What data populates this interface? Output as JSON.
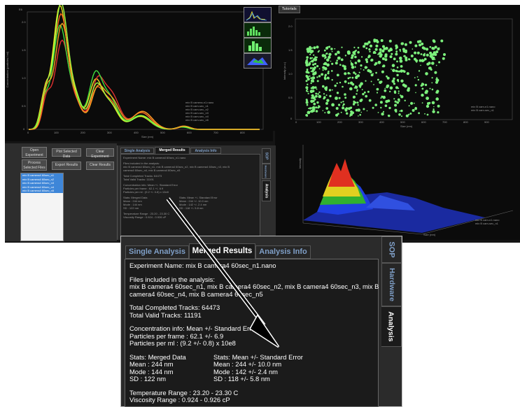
{
  "dist_chart": {
    "y_axis_label": "Concentration (particles / ml)",
    "x_axis_label": "Size (nm)",
    "y_scale_label": "E6",
    "y_ticks": [
      "2.0",
      "1.5",
      "1.0",
      "0.5",
      "0"
    ],
    "x_ticks": [
      "0",
      "100",
      "200",
      "300",
      "400",
      "500",
      "600",
      "700",
      "800"
    ],
    "legend": [
      "mix B camera-n1.nano",
      "mix B cam-sec_n1",
      "mix B cam-sec_n2",
      "mix B cam-sec_n3",
      "mix B cam-sec_n4",
      "mix B cam-sec_n5"
    ],
    "colors": [
      "#f0e020",
      "#ff6a20",
      "#e03030",
      "#40e040",
      "#a0ff40",
      "#f0a020"
    ]
  },
  "thumbnails": [
    "distribution",
    "scatter",
    "green-histogram",
    "3d-plot"
  ],
  "scatter_chart": {
    "header_tab": "Tutorials",
    "y_axis_label": "Intensity (a.u.)",
    "x_axis_label": "Size (nm)",
    "y_ticks": [
      "2.0",
      "1.5",
      "1.0",
      "0.5",
      "0"
    ],
    "x_ticks": [
      "0",
      "100",
      "200",
      "300",
      "400",
      "500",
      "600",
      "700",
      "800",
      "900"
    ],
    "legend": [
      "mix B cam-n1.nano",
      "mix B cam-sec_n1"
    ]
  },
  "surface_chart": {
    "z_axis_label": "Intensity",
    "x_axis_label": "Size (nm)",
    "legend": [
      "mix B cam-n1.nano",
      "mix B cam-sec_n1"
    ]
  },
  "controls": {
    "buttons": [
      "Open Experiment",
      "Plot Selected Data",
      "Clear Experiment",
      "Process Selected Files",
      "Export Results",
      "Clear Results"
    ],
    "files": [
      "mix B camera4 60sec_n1",
      "mix B camera4 60sec_n2",
      "mix B camera4 60sec_n3",
      "mix B camera4 60sec_n4",
      "mix B camera4 60sec_n5"
    ]
  },
  "results_panel": {
    "tabs": {
      "single": "Single Analysis",
      "merged": "Merged Results",
      "info": "Analysis Info"
    },
    "side_tabs": {
      "sop": "SOP",
      "hardware": "Hardware",
      "analysis": "Analysis"
    },
    "experiment_name": "Experiment Name: mix B camera4 60sec_n1.nano",
    "files_title": "Files included in the analysis:",
    "files_line1": "mix B camera4 60sec_n1, mix B camera4 60sec_n2, mix B camera4 60sec_n3, mix B",
    "files_line2": "camera4 60sec_n4, mix B camera4 60sec_n5",
    "total_completed": "Total Completed Tracks: 64473",
    "total_valid": "Total Valid Tracks: 11191",
    "conc_title": "Concentration info: Mean +/- Standard Error",
    "particles_frame": "Particles per frame : 62.1 +/- 6.9",
    "particles_ml": "Particles per ml : (9.2 +/- 0.8) x 10e8",
    "stats_left_title": "Stats: Merged Data",
    "stats_left_mean": "Mean : 244 nm",
    "stats_left_mode": "Mode : 144 nm",
    "stats_left_sd": "SD : 122 nm",
    "stats_right_title": "Stats: Mean +/- Standard Error",
    "stats_right_mean": "Mean : 244 +/- 10.0 nm",
    "stats_right_mode": "Mode : 142 +/- 2.4 nm",
    "stats_right_sd": "SD : 118 +/- 5.8 nm",
    "temperature": "Temperature Range : 23.20 - 23.30 C",
    "viscosity": "Viscosity Range : 0.924 - 0.926 cP"
  },
  "colors": {
    "arrow": "#000000",
    "tab_text": "#7f9fc7",
    "panel_bg": "#2d2d2d"
  }
}
